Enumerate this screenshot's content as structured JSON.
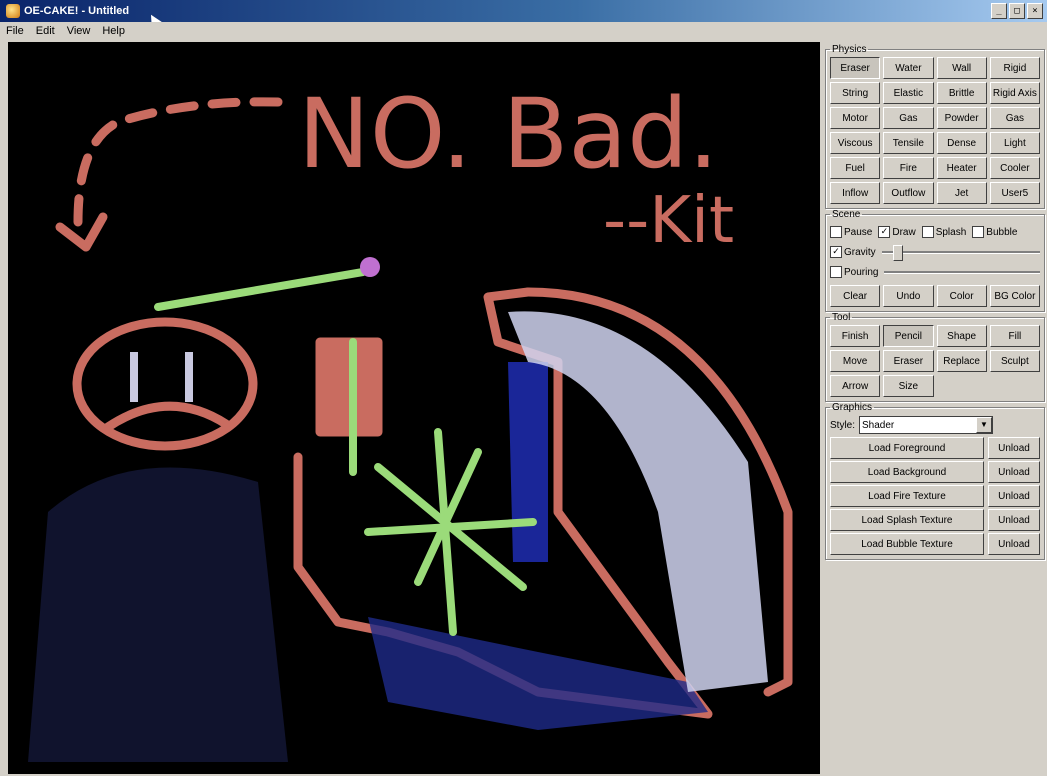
{
  "window": {
    "title": "OE-CAKE! - Untitled",
    "controls": [
      "_",
      "□",
      "×"
    ]
  },
  "menu": [
    "File",
    "Edit",
    "View",
    "Help"
  ],
  "physics": {
    "legend": "Physics",
    "buttons": [
      "Eraser",
      "Water",
      "Wall",
      "Rigid",
      "String",
      "Elastic",
      "Brittle",
      "Rigid Axis",
      "Motor",
      "Gas",
      "Powder",
      "Gas",
      "Viscous",
      "Tensile",
      "Dense",
      "Light",
      "Fuel",
      "Fire",
      "Heater",
      "Cooler",
      "Inflow",
      "Outflow",
      "Jet",
      "User5"
    ],
    "selected": "Eraser"
  },
  "scene": {
    "legend": "Scene",
    "checks": [
      {
        "label": "Pause",
        "checked": false
      },
      {
        "label": "Draw",
        "checked": true
      },
      {
        "label": "Splash",
        "checked": false
      },
      {
        "label": "Bubble",
        "checked": false
      }
    ],
    "gravity": {
      "label": "Gravity",
      "checked": true,
      "level": 0.06
    },
    "pouring": {
      "label": "Pouring",
      "checked": false,
      "level": 1.0
    },
    "buttons": [
      "Clear",
      "Undo",
      "Color",
      "BG Color"
    ]
  },
  "tool": {
    "legend": "Tool",
    "buttons": [
      "Finish",
      "Pencil",
      "Shape",
      "Fill",
      "Move",
      "Eraser",
      "Replace",
      "Sculpt",
      "Arrow",
      "Size"
    ],
    "selected": "Pencil"
  },
  "graphics": {
    "legend": "Graphics",
    "style_label": "Style:",
    "style_value": "Shader",
    "loaders": [
      {
        "label": "Load Foreground",
        "unload": "Unload"
      },
      {
        "label": "Load Background",
        "unload": "Unload"
      },
      {
        "label": "Load Fire Texture",
        "unload": "Unload"
      },
      {
        "label": "Load Splash Texture",
        "unload": "Unload"
      },
      {
        "label": "Load Bubble Texture",
        "unload": "Unload"
      }
    ]
  },
  "canvas": {
    "text_main": "NO. Bad.",
    "text_sign": "--Kit",
    "colors": {
      "wall": "#c96c60",
      "water": "#1e2a8a",
      "gas": "#d0d4f0",
      "elastic": "#9bdb7a",
      "bg": "#000000"
    }
  }
}
